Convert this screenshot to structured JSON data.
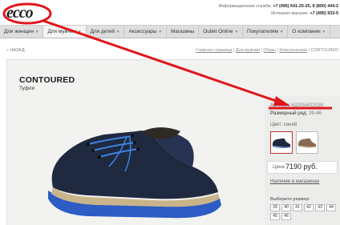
{
  "header": {
    "logo_text": "ecco",
    "info_label": "Информационная служба:",
    "info_phones": "+7 (495) 641-25-25, 8 (800) 444-2",
    "shop_label": "Интернет-магазин:",
    "shop_phone": "+7 (495) 933-5"
  },
  "nav": {
    "items": [
      {
        "label": "Для женщин",
        "caret": "▼"
      },
      {
        "label": "Для мужчин",
        "caret": "▼"
      },
      {
        "label": "Для детей",
        "caret": "▼"
      },
      {
        "label": "Аксессуары",
        "caret": "▼"
      },
      {
        "label": "Магазины"
      },
      {
        "label": "Outlet Online",
        "caret": "▼"
      },
      {
        "label": "Покупателям",
        "caret": "▼"
      },
      {
        "label": "О компании",
        "caret": "▼"
      }
    ]
  },
  "back": "« НАЗАД",
  "breadcrumbs": {
    "home": "Главная страница",
    "men": "Для мужчин",
    "shoes": "Обувь",
    "classic": "Классическая",
    "current": "CONTOURED"
  },
  "product": {
    "title": "CONTOURED",
    "subtitle": "Туфли",
    "article_label": "Артикул:",
    "article_value": "632054/02038",
    "size_range_label": "Размерный ряд:",
    "size_range_value": "39-46",
    "color_label": "Цвет:",
    "color_value": "синий",
    "price_label": "Цена",
    "price_value": "7190 руб.",
    "stock_link": "Наличие в магазинах",
    "choose_size": "Выберите размер:",
    "sizes": [
      "39",
      "40",
      "41",
      "42",
      "43",
      "44",
      "45",
      "46"
    ]
  },
  "colors": {
    "annotation_red": "#e0161b",
    "shoe_navy": "#1f2940",
    "sole_blue": "#2c5cc4"
  }
}
